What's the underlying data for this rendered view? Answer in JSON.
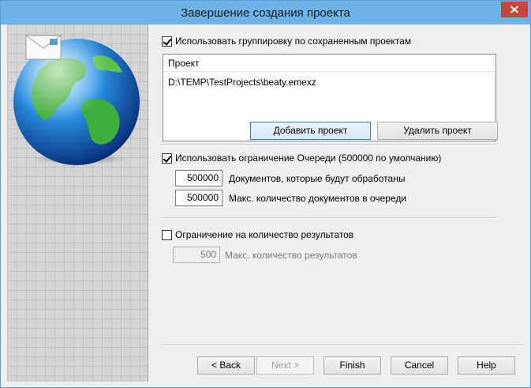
{
  "window": {
    "title": "Завершение создания проекта"
  },
  "grouping": {
    "label": "Использовать группировку по сохраненным проектам",
    "checked": true
  },
  "projects": {
    "column_header": "Проект",
    "rows": [
      "D:\\TEMP\\TestProjects\\beaty.emexz"
    ]
  },
  "project_buttons": {
    "add": "Добавить проект",
    "remove": "Удалить проект"
  },
  "queue": {
    "label": "Использовать ограничение Очереди (500000 по умолчанию)",
    "checked": true,
    "docs_value": "500000",
    "docs_label": "Документов, которые будут обработаны",
    "max_value": "500000",
    "max_label": "Макс. количество документов в очереди"
  },
  "results": {
    "label": "Ограничение на количество результатов",
    "checked": false,
    "value": "500",
    "value_label": "Макс. количество результатов"
  },
  "nav": {
    "back": "< Back",
    "next": "Next >",
    "finish": "Finish",
    "cancel": "Cancel",
    "help": "Help"
  },
  "colors": {
    "titlebar": "#6eb4e8",
    "close_button": "#c7463c"
  }
}
